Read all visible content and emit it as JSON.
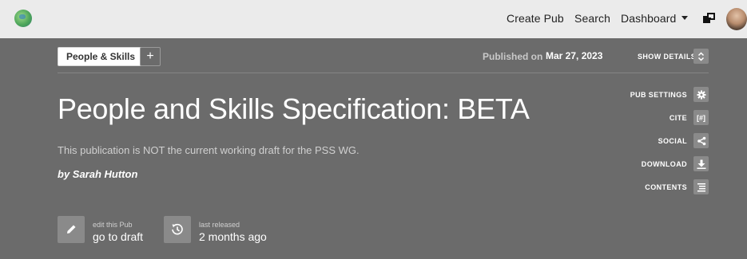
{
  "topbar": {
    "create_pub": "Create Pub",
    "search": "Search",
    "dashboard": "Dashboard"
  },
  "header": {
    "collection_tag": "People & Skills",
    "add_label": "+",
    "published_label": "Published on",
    "published_date": "Mar 27, 2023",
    "show_details": "SHOW DETAILS"
  },
  "pub": {
    "title": "People and Skills Specification: BETA",
    "subtitle": "This publication is NOT the current working draft for the PSS WG.",
    "byline": "by Sarah Hutton"
  },
  "side_actions": [
    {
      "label": "PUB SETTINGS",
      "icon": "gear-icon"
    },
    {
      "label": "CITE",
      "icon": "cite-icon"
    },
    {
      "label": "SOCIAL",
      "icon": "share-icon"
    },
    {
      "label": "DOWNLOAD",
      "icon": "download-icon"
    },
    {
      "label": "CONTENTS",
      "icon": "list-icon"
    }
  ],
  "bottom_actions": {
    "edit": {
      "small": "edit this Pub",
      "big": "go to draft",
      "icon": "pencil-icon"
    },
    "release": {
      "small": "last released",
      "big": "2 months ago",
      "icon": "history-icon"
    }
  },
  "colors": {
    "topbar_bg": "#ebebeb",
    "hero_bg": "#6b6b6b",
    "button_bg": "#8a8a8a"
  }
}
